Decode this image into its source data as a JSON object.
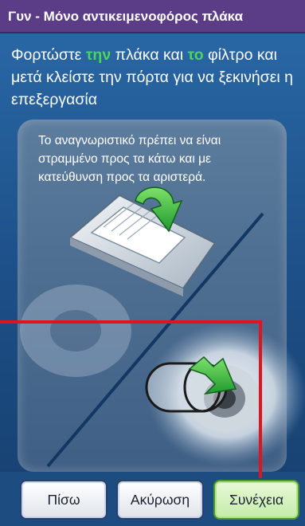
{
  "title": "Γυν - Μόνο αντικειμενοφόρος πλάκα",
  "instruction": {
    "part1": "Φορτώστε ",
    "hl1": "την",
    "part2": " πλάκα και ",
    "hl2": "το",
    "part3": " φίλτρο και μετά κλείστε την πόρτα για να ξεκινήσει η επεξεργασία"
  },
  "orientation_note": "Το αναγνωριστικό πρέπει να είναι στραμμένο προς τα κάτω και με κατεύθυνση προς τα αριστερά.",
  "buttons": {
    "back": "Πίσω",
    "cancel": "Ακύρωση",
    "continue": "Συνέχεια"
  },
  "colors": {
    "title_bar": "#5b3c87",
    "highlight_text": "#49d65a",
    "arrow": "#2fb83e",
    "annotation_line": "#e0141c"
  },
  "icons": [
    "slide-illustration",
    "rotate-arrow-icon",
    "filter-insert-arrow-icon"
  ]
}
